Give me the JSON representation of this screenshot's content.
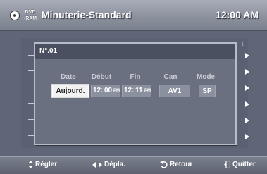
{
  "header": {
    "disc_line1": "DVD",
    "disc_line2": "-RAM",
    "title": "Minuterie-Standard",
    "clock": "12:00 AM"
  },
  "background": {
    "column_label": "l."
  },
  "dialog": {
    "number": "N°.01",
    "columns": {
      "date": "Date",
      "start": "Début",
      "end": "Fin",
      "channel": "Can",
      "mode": "Mode"
    },
    "fields": {
      "date": "Aujourd.",
      "start_hour": "12",
      "start_minute": "00",
      "start_ampm": "PM",
      "end_hour": "12",
      "end_minute": "11",
      "end_ampm": "PM",
      "channel": "AV1",
      "mode": "SP"
    }
  },
  "footer": {
    "adjust": "Régler",
    "move": "Dépla.",
    "back": "Retour",
    "exit": "Quitter"
  },
  "icons": {
    "disc": "disc-icon",
    "updown": "updown-arrows-icon",
    "leftright": "leftright-arrows-icon",
    "return": "return-icon",
    "exit": "exit-icon"
  }
}
